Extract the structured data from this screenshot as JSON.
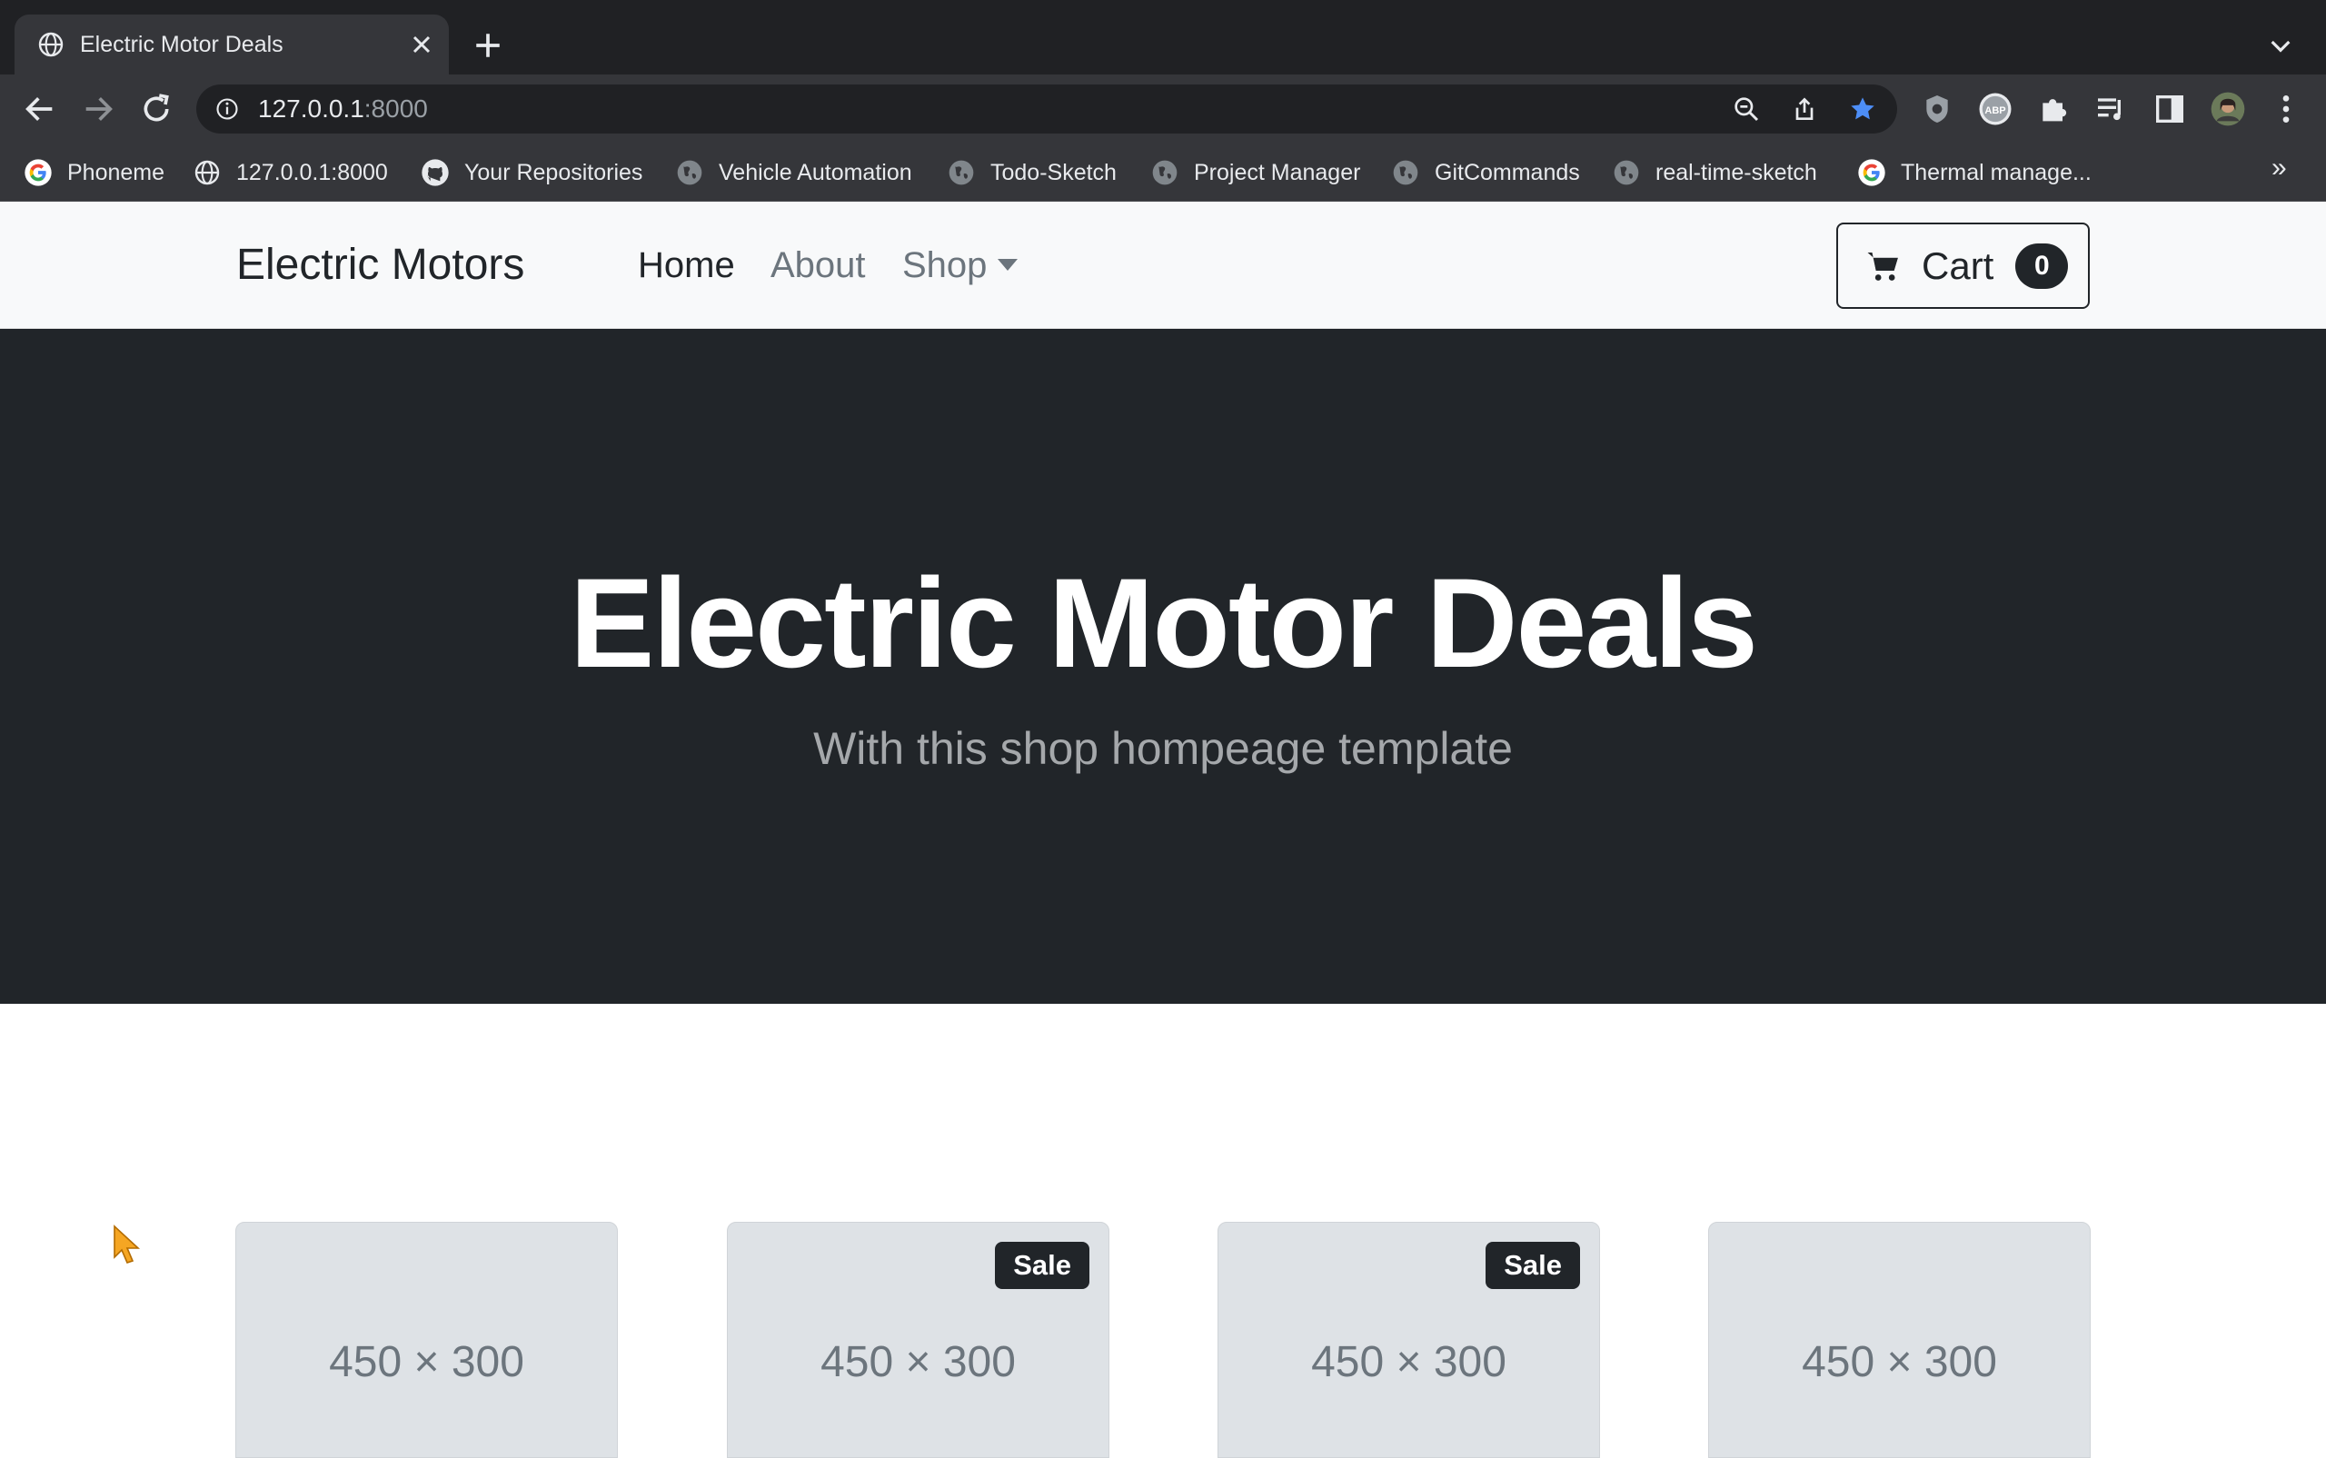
{
  "browser": {
    "tab_title": "Electric Motor Deals",
    "url_host": "127.0.0.1",
    "url_port": ":8000",
    "bookmarks": [
      {
        "label": "Phoneme",
        "icon": "google-icon"
      },
      {
        "label": "127.0.0.1:8000",
        "icon": "globe-icon"
      },
      {
        "label": "Your Repositories",
        "icon": "github-icon"
      },
      {
        "label": "Vehicle Automation",
        "icon": "globe-icon"
      },
      {
        "label": "Todo-Sketch",
        "icon": "globe-icon"
      },
      {
        "label": "Project Manager",
        "icon": "globe-icon"
      },
      {
        "label": "GitCommands",
        "icon": "globe-icon"
      },
      {
        "label": "real-time-sketch",
        "icon": "globe-icon"
      },
      {
        "label": "Thermal manage...",
        "icon": "google-icon"
      }
    ],
    "bookmarks_overflow": "»",
    "colors": {
      "star": "#4d8ef7",
      "chrome_dark": "#202124",
      "chrome": "#35363a"
    }
  },
  "site": {
    "brand": "Electric Motors",
    "nav": {
      "home": "Home",
      "about": "About",
      "shop": "Shop"
    },
    "cart": {
      "label": "Cart",
      "count": "0"
    }
  },
  "hero": {
    "title": "Electric Motor Deals",
    "subtitle": "With this shop hompeage template"
  },
  "products": [
    {
      "placeholder": "450 × 300",
      "badge": ""
    },
    {
      "placeholder": "450 × 300",
      "badge": "Sale"
    },
    {
      "placeholder": "450 × 300",
      "badge": "Sale"
    },
    {
      "placeholder": "450 × 300",
      "badge": ""
    }
  ]
}
